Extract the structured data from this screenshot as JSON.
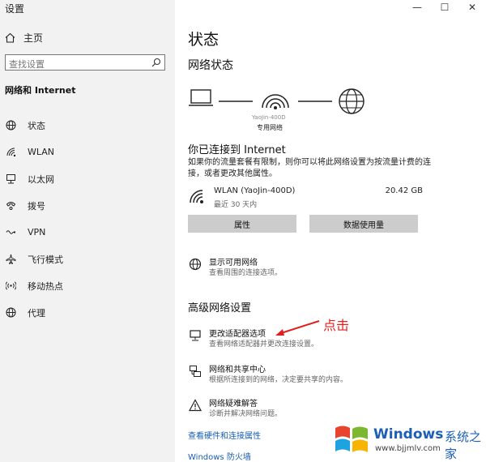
{
  "window": {
    "title": "设置",
    "controls": [
      "—",
      "☐",
      "✕"
    ]
  },
  "sidebar": {
    "home_label": "主页",
    "search_placeholder": "查找设置",
    "section_title": "网络和 Internet",
    "items": [
      {
        "label": "状态",
        "icon": "globe-icon"
      },
      {
        "label": "WLAN",
        "icon": "wifi-icon"
      },
      {
        "label": "以太网",
        "icon": "ethernet-icon"
      },
      {
        "label": "拨号",
        "icon": "dialup-icon"
      },
      {
        "label": "VPN",
        "icon": "vpn-icon"
      },
      {
        "label": "飞行模式",
        "icon": "airplane-icon"
      },
      {
        "label": "移动热点",
        "icon": "hotspot-icon"
      },
      {
        "label": "代理",
        "icon": "proxy-icon"
      }
    ]
  },
  "main": {
    "title": "状态",
    "network_status_heading": "网络状态",
    "diagram_network_name": "专用网络",
    "diagram_ssid_partial": "YaoJin-400D",
    "connected_heading": "你已连接到 Internet",
    "connected_desc": "如果你的流量套餐有限制，则你可以将此网络设置为按流量计费的连接，或者更改其他属性。",
    "connection": {
      "name": "WLAN (YaoJin-400D)",
      "period": "最近 30 天内",
      "usage": "20.42 GB"
    },
    "buttons": {
      "properties": "属性",
      "data_usage": "数据使用量"
    },
    "show_networks": {
      "title": "显示可用网络",
      "desc": "查看周围的连接选项。"
    },
    "advanced_heading": "高级网络设置",
    "annotation": "点击",
    "adapter_options": {
      "title": "更改适配器选项",
      "desc": "查看网络适配器并更改连接设置。"
    },
    "sharing_center": {
      "title": "网络和共享中心",
      "desc": "根据所连接到的网络，决定要共享的内容。"
    },
    "troubleshooter": {
      "title": "网络疑难解答",
      "desc": "诊断并解决网络问题。"
    },
    "links": {
      "hardware": "查看硬件和连接属性",
      "firewall": "Windows 防火墙"
    }
  },
  "watermark": {
    "brand": "Windows",
    "suffix": "系统之家",
    "url": "www.bjjmlv.com"
  },
  "colors": {
    "sidebar_bg": "#f2f2f2",
    "link": "#1a5fb4",
    "annotation": "#e02020",
    "button_bg": "#cccccc"
  }
}
